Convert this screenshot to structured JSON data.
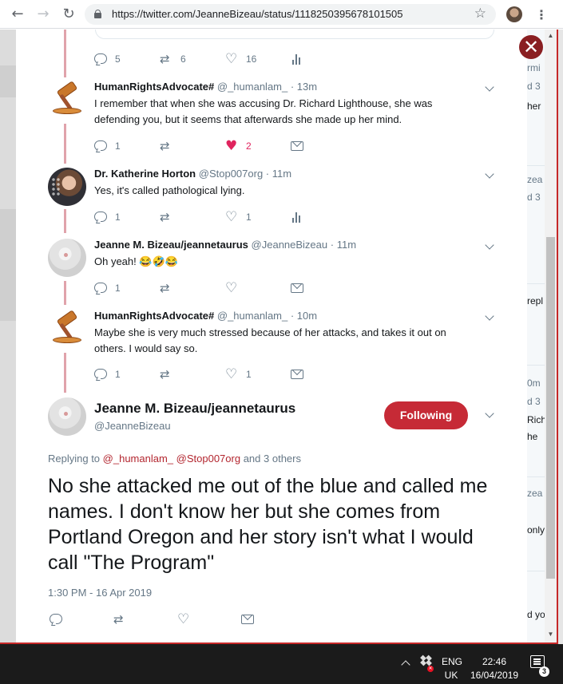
{
  "browser": {
    "url": "https://twitter.com/JeanneBizeau/status/1118250395678101505",
    "back_icon": "arrow-left",
    "forward_icon": "arrow-right",
    "reload_icon": "reload",
    "star_icon": "star",
    "menu_icon": "kebab"
  },
  "colors": {
    "accent": "#c62a36",
    "like": "#e0245e",
    "muted": "#657786",
    "thread_line": "#e0a3ab"
  },
  "background_fragments": [
    "rmi",
    "d 3",
    "her",
    "zea",
    "d 3",
    "repl",
    "0m",
    "d 3",
    "Rich",
    "he",
    "zea",
    "only",
    "d yo"
  ],
  "previous_tweet_actions": {
    "reply_count": "5",
    "retweet_count": "6",
    "like_count": "16"
  },
  "tweets": [
    {
      "name": "HumanRightsAdvocate#",
      "handle": "@_humanlam_",
      "time": "· 13m",
      "text": "I remember that when she was accusing Dr. Richard Lighthouse, she was defending you, but it seems that afterwards she made up her mind.",
      "reply_count": "1",
      "like_count": "2"
    },
    {
      "name": "Dr. Katherine Horton",
      "handle": "@Stop007org",
      "time": "· 11m",
      "text": "Yes, it's called pathological lying.",
      "reply_count": "1",
      "like_count": "1"
    },
    {
      "name": "Jeanne M. Bizeau/jeannetaurus",
      "handle": "@JeanneBizeau",
      "time": "· 11m",
      "text": "Oh yeah! 😂🤣😂",
      "reply_count": "1"
    },
    {
      "name": "HumanRightsAdvocate#",
      "handle": "@_humanlam_",
      "time": "· 10m",
      "text": "Maybe she is very much stressed because of her attacks, and takes it out on others. I would say so.",
      "reply_count": "1",
      "like_count": "1"
    }
  ],
  "main_tweet": {
    "name": "Jeanne M. Bizeau/jeannetaurus",
    "handle": "@JeanneBizeau",
    "follow_label": "Following",
    "replying_prefix": "Replying to",
    "mention_1": "@_humanlam_",
    "mention_2": "@Stop007org",
    "replying_suffix": "and 3 others",
    "text": "No she attacked me out of the blue and called me names. I don't know her but she comes from Portland Oregon and her story isn't what I would call \"The Program\"",
    "timestamp": "1:30 PM - 16 Apr 2019"
  },
  "close_label": "✕",
  "taskbar": {
    "lang_top": "ENG",
    "lang_bottom": "UK",
    "time": "22:46",
    "date": "16/04/2019",
    "notifications": "3"
  }
}
